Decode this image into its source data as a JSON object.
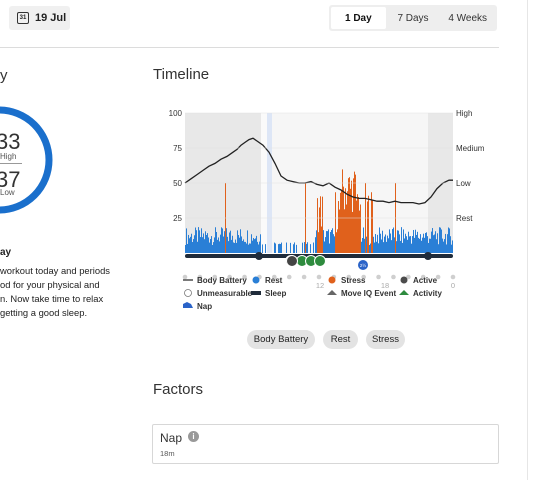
{
  "header": {
    "date_label": "19 Jul",
    "calendar_day": "31",
    "range_tabs": [
      "1 Day",
      "7 Days",
      "4 Weeks"
    ],
    "active_range": "1 Day"
  },
  "left": {
    "section_title_fragment": "y",
    "ring_value_high": "33",
    "ring_label_high": "High",
    "ring_value_low": "37",
    "ring_label_low": "Low",
    "ring_color": "#1a6fcc",
    "summary_title": "ay",
    "summary_lines": [
      "workout today and periods",
      "od for your physical and",
      "n. Now take time to relax",
      "getting a good sleep."
    ]
  },
  "timeline": {
    "title": "Timeline",
    "left_ticks": [
      "100",
      "75",
      "50",
      "25"
    ],
    "right_ticks": [
      "High",
      "Medium",
      "Low",
      "Rest"
    ],
    "x_ticks": [
      "12",
      "18",
      "0"
    ],
    "colors": {
      "rest": "#2a7fd6",
      "stress": "#e0611c",
      "battery_line": "#222222",
      "sleep_shade": "#e8e8e8",
      "active": "#4c4c4c",
      "activity": "#2e8b3e"
    },
    "legend": [
      {
        "label": "Body Battery",
        "icon": "line-icon"
      },
      {
        "label": "Rest",
        "icon": "blue-dot-icon"
      },
      {
        "label": "Stress",
        "icon": "orange-dot-icon"
      },
      {
        "label": "Active",
        "icon": "gray-dot-icon"
      },
      {
        "label": "Unmeasurable",
        "icon": "hollow-circle-icon"
      },
      {
        "label": "Sleep",
        "icon": "sleep-icon"
      },
      {
        "label": "Move IQ Event",
        "icon": "move-iq-icon"
      },
      {
        "label": "Activity",
        "icon": "activity-icon"
      },
      {
        "label": "Nap",
        "icon": "nap-icon"
      }
    ],
    "marker_badge": "2½"
  },
  "chart_data": {
    "type": "line",
    "title": "",
    "xlabel": "",
    "ylabel": "",
    "ylim": [
      0,
      100
    ],
    "x_tick_labels": [
      "12",
      "18",
      "0"
    ],
    "series": [
      {
        "name": "Body Battery",
        "x": [
          0,
          6,
          12,
          18,
          24,
          30,
          36,
          42,
          48,
          52,
          56,
          60,
          64,
          68,
          72,
          78,
          84,
          90,
          96,
          102,
          108,
          114,
          120,
          126,
          132,
          138,
          144,
          150,
          156,
          162,
          168,
          174,
          180,
          186,
          192,
          198,
          204,
          210,
          216,
          222,
          228,
          234,
          240,
          246,
          252,
          258,
          264,
          268
        ],
        "y": [
          50,
          53,
          56,
          59,
          62,
          64,
          67,
          69,
          72,
          74,
          77,
          79,
          81,
          82,
          80,
          77,
          72,
          64,
          55,
          52,
          51,
          50,
          50,
          51,
          49,
          48,
          50,
          47,
          45,
          42,
          40,
          39,
          39,
          38,
          37,
          37,
          36,
          37,
          36,
          36,
          36,
          35,
          36,
          40,
          46,
          50,
          52,
          52
        ]
      }
    ]
  },
  "buttons": [
    "Body Battery",
    "Rest",
    "Stress"
  ],
  "factors": {
    "title": "Factors",
    "items": [
      {
        "name": "Nap",
        "value": "18m"
      }
    ]
  }
}
